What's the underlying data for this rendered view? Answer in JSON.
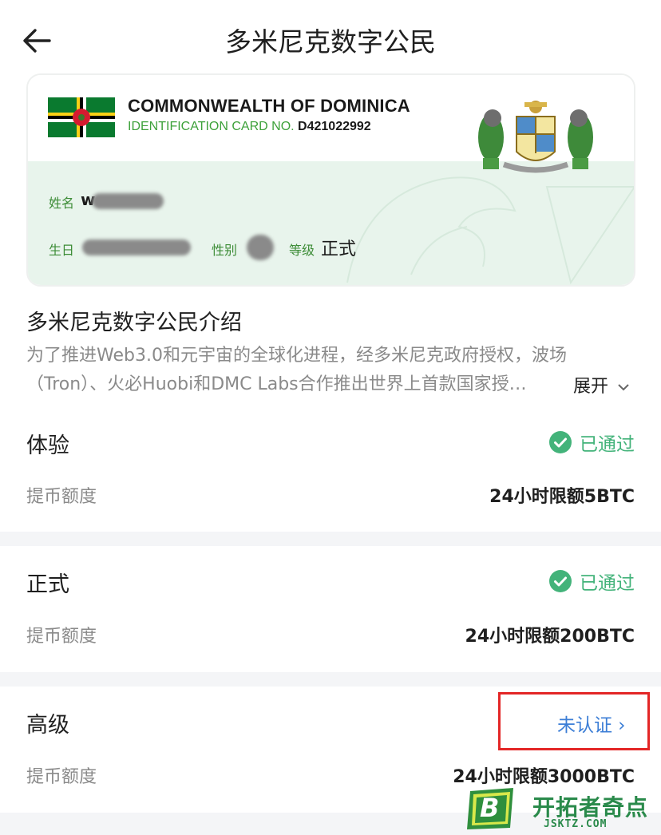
{
  "header": {
    "title": "多米尼克数字公民"
  },
  "card": {
    "country": "COMMONWEALTH OF DOMINICA",
    "id_label": "IDENTIFICATION CARD NO.",
    "id_number": "D421022992",
    "name_label": "姓名",
    "name_value_visible": "w",
    "birth_label": "生日",
    "gender_label": "性别",
    "level_label": "等级",
    "level_value": "正式"
  },
  "intro": {
    "title": "多米尼克数字公民介绍",
    "line1": "为了推进Web3.0和元宇宙的全球化进程，经多米尼克政府授权，波场",
    "line2": "（Tron）、火必Huobi和DMC Labs合作推出世界上首款国家授…",
    "expand_label": "展开"
  },
  "tiers": [
    {
      "name": "体验",
      "status": "已通过",
      "quota_label": "提币额度",
      "quota_value": "24小时限额5BTC"
    },
    {
      "name": "正式",
      "status": "已通过",
      "quota_label": "提币额度",
      "quota_value": "24小时限额200BTC"
    },
    {
      "name": "高级",
      "status": "未认证 ›",
      "quota_label": "提币额度",
      "quota_value": "24小时限额3000BTC"
    }
  ],
  "watermark_logo": {
    "letter": "B",
    "name": "开拓者奇点",
    "url": "JSKTZ.COM"
  },
  "colors": {
    "verified": "#43b37a",
    "unverified": "#3c7ed6",
    "highlight": "#e32626",
    "label_green": "#3c8c36"
  }
}
